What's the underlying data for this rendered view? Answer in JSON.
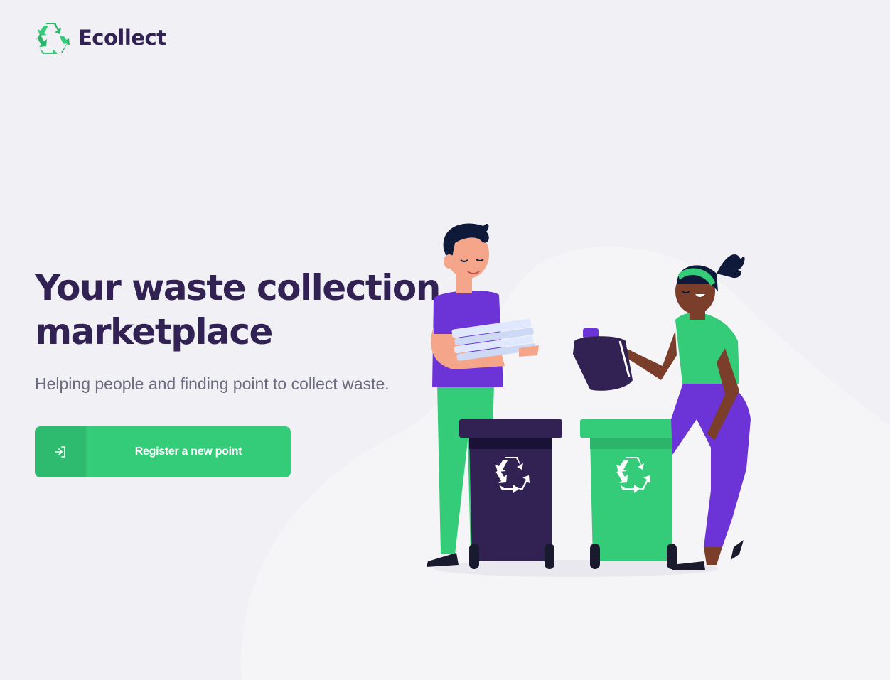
{
  "app": {
    "logo_text": "Ecollect",
    "logo_icon": "recycle-icon"
  },
  "hero": {
    "title": "Your waste collection marketplace",
    "subtitle": "Helping people and finding point to collect waste."
  },
  "cta": {
    "label": "Register a new point",
    "icon": "sign-in-icon"
  },
  "colors": {
    "primary": "#34cb79",
    "title": "#322153",
    "text": "#6c6c80",
    "background": "#f0f0f5",
    "accent_purple": "#6c33d6",
    "bin_dark": "#322153"
  }
}
